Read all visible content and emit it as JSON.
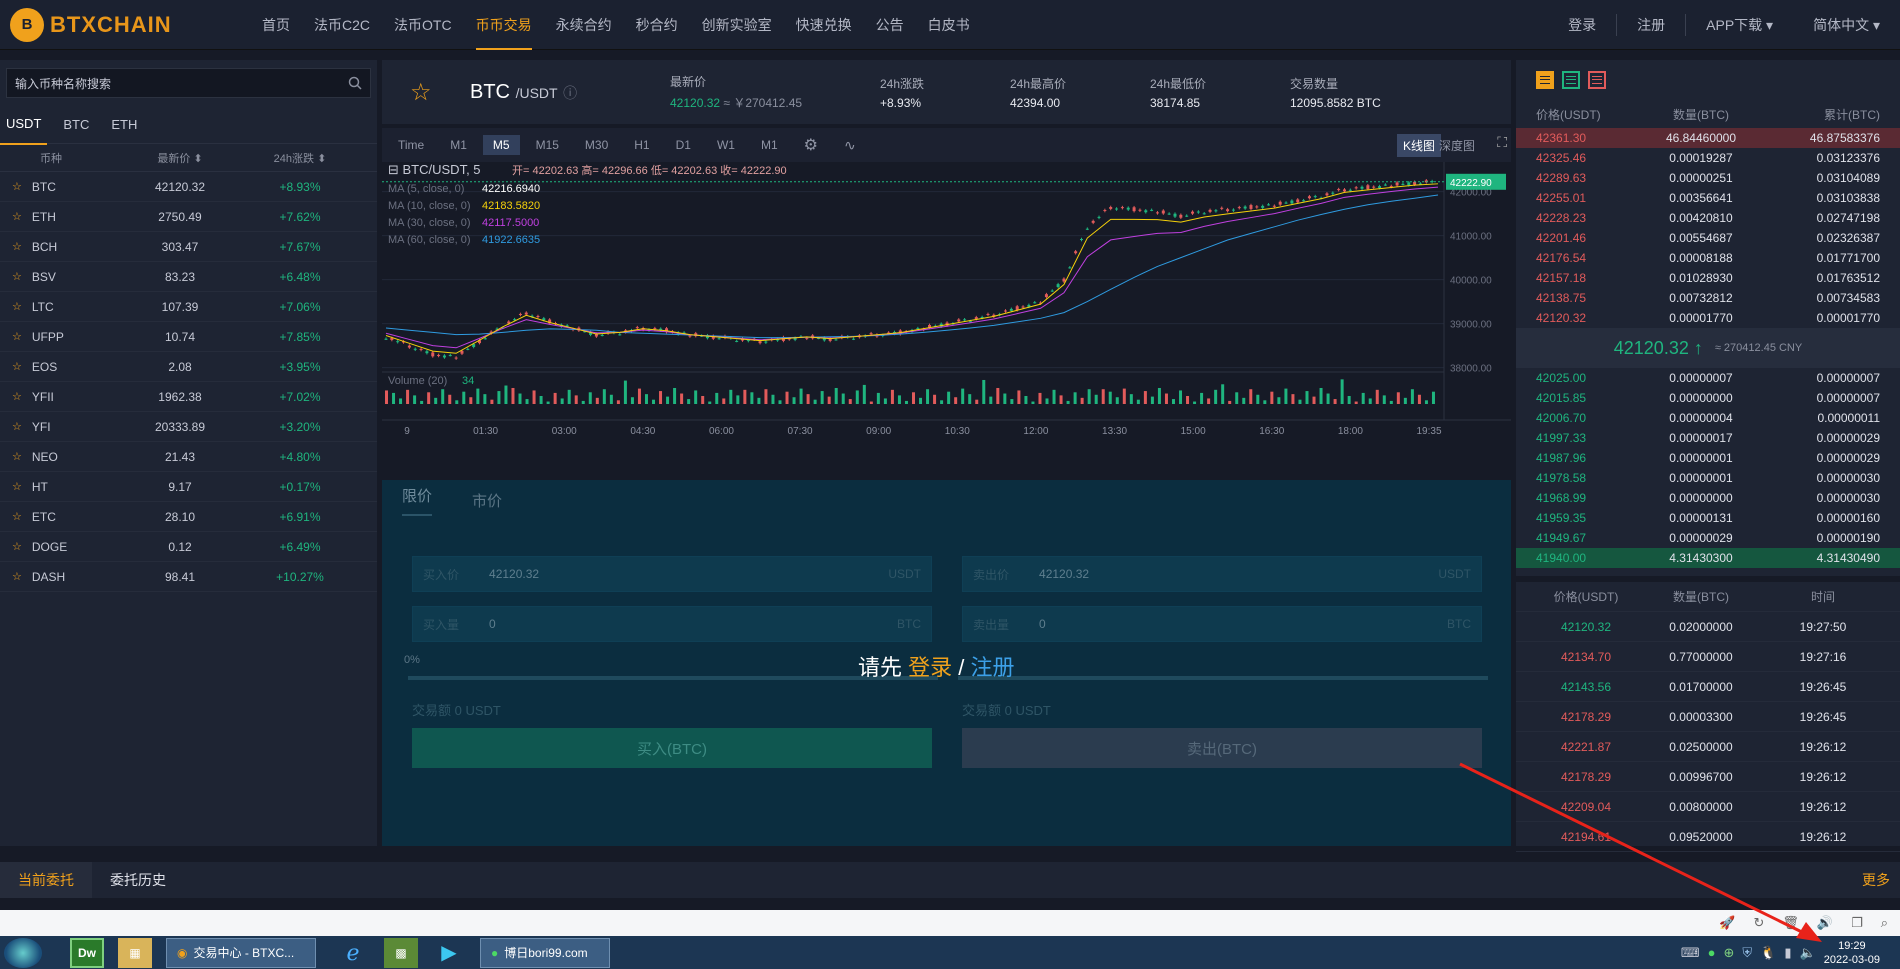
{
  "header": {
    "logo_letter": "B",
    "logo_text": "BTXCHAIN",
    "nav": [
      "首页",
      "法币C2C",
      "法币OTC",
      "币币交易",
      "永续合约",
      "秒合约",
      "创新实验室",
      "快速兑换",
      "公告",
      "白皮书"
    ],
    "login": "登录",
    "register": "注册",
    "app_download": "APP下载 ▾",
    "language": "简体中文 ▾"
  },
  "left": {
    "search_placeholder": "输入币种名称搜索",
    "tabs": [
      "USDT",
      "BTC",
      "ETH"
    ],
    "head": {
      "coin": "币种",
      "price": "最新价 ⬍",
      "change": "24h涨跌 ⬍"
    },
    "coins": [
      {
        "name": "BTC",
        "price": "42120.32",
        "change": "+8.93%"
      },
      {
        "name": "ETH",
        "price": "2750.49",
        "change": "+7.62%"
      },
      {
        "name": "BCH",
        "price": "303.47",
        "change": "+7.67%"
      },
      {
        "name": "BSV",
        "price": "83.23",
        "change": "+6.48%"
      },
      {
        "name": "LTC",
        "price": "107.39",
        "change": "+7.06%"
      },
      {
        "name": "UFPP",
        "price": "10.74",
        "change": "+7.85%"
      },
      {
        "name": "EOS",
        "price": "2.08",
        "change": "+3.95%"
      },
      {
        "name": "YFII",
        "price": "1962.38",
        "change": "+7.02%"
      },
      {
        "name": "YFI",
        "price": "20333.89",
        "change": "+3.20%"
      },
      {
        "name": "NEO",
        "price": "21.43",
        "change": "+4.80%"
      },
      {
        "name": "HT",
        "price": "9.17",
        "change": "+0.17%"
      },
      {
        "name": "ETC",
        "price": "28.10",
        "change": "+6.91%"
      },
      {
        "name": "DOGE",
        "price": "0.12",
        "change": "+6.49%"
      },
      {
        "name": "DASH",
        "price": "98.41",
        "change": "+10.27%"
      }
    ]
  },
  "ticker": {
    "pair_base": "BTC",
    "pair_quote": "/USDT",
    "latest_label": "最新价",
    "latest_value": "42120.32",
    "latest_cny": " ≈ ￥270412.45",
    "change_label": "24h涨跌",
    "change_value": "+8.93%",
    "high_label": "24h最高价",
    "high_value": "42394.00",
    "low_label": "24h最低价",
    "low_value": "38174.85",
    "vol_label": "交易数量",
    "vol_value": "12095.8582 BTC"
  },
  "chart_toolbar": {
    "timeframes": [
      "Time",
      "M1",
      "M5",
      "M15",
      "M30",
      "H1",
      "D1",
      "W1",
      "M1"
    ],
    "active": "M5",
    "kline": "K线图",
    "depth": "深度图"
  },
  "chart_data": {
    "type": "line",
    "title": "BTC/USDT, 5",
    "ohlc": "开= 42202.63  高= 42296.66  低= 42202.63  收= 42222.90",
    "ma": [
      {
        "label": "MA (5, close, 0)",
        "value": "42216.6940",
        "color": "#ffffff"
      },
      {
        "label": "MA (10, close, 0)",
        "value": "42183.5820",
        "color": "#f5d10a"
      },
      {
        "label": "MA (30, close, 0)",
        "value": "42117.5000",
        "color": "#c040e0"
      },
      {
        "label": "MA (60, close, 0)",
        "value": "41922.6635",
        "color": "#2f9be0"
      }
    ],
    "last_price_tag": "42222.90",
    "ylim": [
      37900,
      42400
    ],
    "yticks": [
      "42000.00",
      "41000.00",
      "40000.00",
      "39000.00",
      "38000.00"
    ],
    "ytick_values": [
      42000,
      41000,
      40000,
      39000,
      38000
    ],
    "xticks": [
      "9",
      "01:30",
      "03:00",
      "04:30",
      "06:00",
      "07:30",
      "09:00",
      "10:30",
      "12:00",
      "13:30",
      "15:00",
      "16:30",
      "18:00",
      "19:35"
    ],
    "price_series": [
      38700,
      38500,
      38300,
      38250,
      38600,
      38950,
      39250,
      39050,
      38900,
      38750,
      38800,
      38900,
      38850,
      38750,
      38700,
      38650,
      38600,
      38650,
      38700,
      38650,
      38700,
      38750,
      38800,
      38900,
      39000,
      39100,
      39200,
      39350,
      39500,
      40000,
      41200,
      41650,
      41600,
      41550,
      41450,
      41550,
      41600,
      41650,
      41700,
      41800,
      41900,
      42050,
      42100,
      42150,
      42200,
      42222
    ],
    "ma60_series": [
      38900,
      38850,
      38800,
      38750,
      38760,
      38800,
      38850,
      38880,
      38870,
      38850,
      38800,
      38780,
      38760,
      38740,
      38720,
      38700,
      38680,
      38680,
      38690,
      38700,
      38710,
      38730,
      38760,
      38800,
      38850,
      38900,
      38960,
      39040,
      39120,
      39250,
      39500,
      39780,
      40050,
      40300,
      40500,
      40700,
      40900,
      41050,
      41200,
      41350,
      41480,
      41600,
      41700,
      41780,
      41850,
      41922
    ],
    "volume_label": "Volume (20)",
    "volume_value": "34",
    "volume_max": 100
  },
  "trade": {
    "tabs": [
      "限价",
      "市价"
    ],
    "buy_price_label": "买入价",
    "buy_price": "42120.32",
    "sell_price_label": "卖出价",
    "sell_price": "42120.32",
    "buy_qty_label": "买入量",
    "buy_qty": "0",
    "sell_qty_label": "卖出量",
    "sell_qty": "0",
    "unit_usdt": "USDT",
    "unit_btc": "BTC",
    "pct": "0%",
    "buy_total": "交易额 0 USDT",
    "sell_total": "交易额 0 USDT",
    "buy_btn": "买入(BTC)",
    "sell_btn": "卖出(BTC)",
    "login_prefix": "请先 ",
    "login": "登录",
    "slash": " / ",
    "register": "注册"
  },
  "book": {
    "head": [
      "价格(USDT)",
      "数量(BTC)",
      "累计(BTC)"
    ],
    "asks": [
      [
        "42361.30",
        "46.84460000",
        "46.87583376"
      ],
      [
        "42325.46",
        "0.00019287",
        "0.03123376"
      ],
      [
        "42289.63",
        "0.00000251",
        "0.03104089"
      ],
      [
        "42255.01",
        "0.00356641",
        "0.03103838"
      ],
      [
        "42228.23",
        "0.00420810",
        "0.02747198"
      ],
      [
        "42201.46",
        "0.00554687",
        "0.02326387"
      ],
      [
        "42176.54",
        "0.00008188",
        "0.01771700"
      ],
      [
        "42157.18",
        "0.01028930",
        "0.01763512"
      ],
      [
        "42138.75",
        "0.00732812",
        "0.00734583"
      ],
      [
        "42120.32",
        "0.00001770",
        "0.00001770"
      ]
    ],
    "mid_price": "42120.32 ↑",
    "mid_cny": "≈ 270412.45 CNY",
    "bids": [
      [
        "42025.00",
        "0.00000007",
        "0.00000007"
      ],
      [
        "42015.85",
        "0.00000000",
        "0.00000007"
      ],
      [
        "42006.70",
        "0.00000004",
        "0.00000011"
      ],
      [
        "41997.33",
        "0.00000017",
        "0.00000029"
      ],
      [
        "41987.96",
        "0.00000001",
        "0.00000029"
      ],
      [
        "41978.58",
        "0.00000001",
        "0.00000030"
      ],
      [
        "41968.99",
        "0.00000000",
        "0.00000030"
      ],
      [
        "41959.35",
        "0.00000131",
        "0.00000160"
      ],
      [
        "41949.67",
        "0.00000029",
        "0.00000190"
      ],
      [
        "41940.00",
        "4.31430300",
        "4.31430490"
      ]
    ]
  },
  "trades": {
    "head": [
      "价格(USDT)",
      "数量(BTC)",
      "时间"
    ],
    "rows": [
      {
        "price": "42120.32",
        "qty": "0.02000000",
        "time": "19:27:50",
        "side": "up"
      },
      {
        "price": "42134.70",
        "qty": "0.77000000",
        "time": "19:27:16",
        "side": "down"
      },
      {
        "price": "42143.56",
        "qty": "0.01700000",
        "time": "19:26:45",
        "side": "up"
      },
      {
        "price": "42178.29",
        "qty": "0.00003300",
        "time": "19:26:45",
        "side": "down"
      },
      {
        "price": "42221.87",
        "qty": "0.02500000",
        "time": "19:26:12",
        "side": "down"
      },
      {
        "price": "42178.29",
        "qty": "0.00996700",
        "time": "19:26:12",
        "side": "down"
      },
      {
        "price": "42209.04",
        "qty": "0.00800000",
        "time": "19:26:12",
        "side": "down"
      },
      {
        "price": "42194.61",
        "qty": "0.09520000",
        "time": "19:26:12",
        "side": "down"
      }
    ]
  },
  "orders": {
    "current": "当前委托",
    "history": "委托历史",
    "more": "更多"
  },
  "taskbar": {
    "task1": "交易中心 - BTXC...",
    "task2": "博日bori99.com",
    "time": "19:29",
    "date": "2022-03-09"
  },
  "colors": {
    "accent": "#f0a11c",
    "up": "#1fb57f",
    "down": "#e25b5b"
  }
}
